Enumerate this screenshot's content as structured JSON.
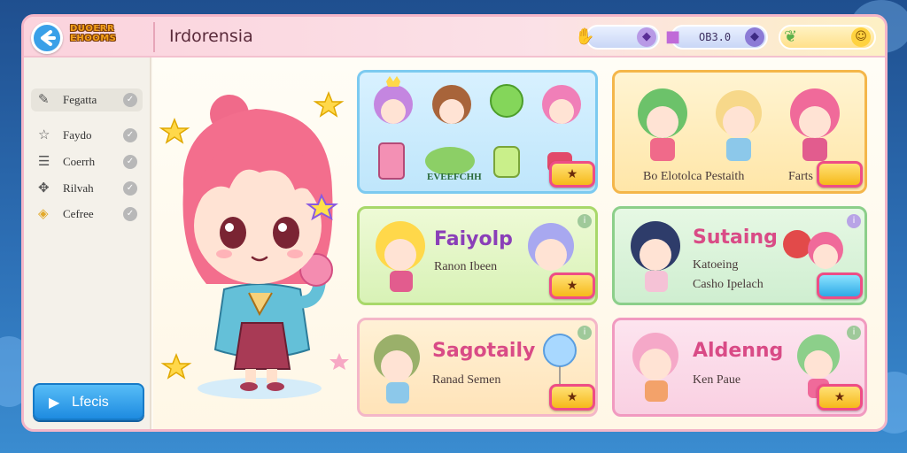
{
  "app": {
    "logo_text": "DUOERR EHOOMS",
    "screen_title": "Irdorensia"
  },
  "topbar": {
    "resource_1_value": "",
    "resource_2_value": "OB3.0",
    "resource_3_value": ""
  },
  "sidebar": {
    "items": [
      {
        "label": "Fegatta",
        "icon": "edit-icon",
        "checked": true
      },
      {
        "label": "Faydo",
        "icon": "star-outline-icon",
        "checked": true
      },
      {
        "label": "Coerrh",
        "icon": "database-icon",
        "checked": true
      },
      {
        "label": "Rilvah",
        "icon": "puzzle-icon",
        "checked": true
      },
      {
        "label": "Cefree",
        "icon": "coins-icon",
        "checked": true
      }
    ],
    "play_button_label": "Lfecis"
  },
  "cards": [
    {
      "id": "card-items",
      "title": "",
      "subtitle": "EVEEFCHH",
      "badge": "",
      "theme": "blue"
    },
    {
      "id": "card-group",
      "title": "",
      "subtitle": "Bo Elotolca Pestaith",
      "extra": "Farts",
      "badge": "",
      "theme": "gold"
    },
    {
      "id": "card-faiyolp",
      "title": "Faiyolp",
      "subtitle": "Ranon Ibeen",
      "badge": "",
      "theme": "green"
    },
    {
      "id": "card-satoing",
      "title": "Sutaing",
      "subtitle_1": "Katoeing",
      "subtitle_2": "Casho Ipelach",
      "badge": "",
      "theme": "mint"
    },
    {
      "id": "card-sagotaily",
      "title": "Sagotaily",
      "subtitle": "Ranad Semen",
      "badge": "",
      "theme": "peach"
    },
    {
      "id": "card-aldening",
      "title": "Aldenng",
      "subtitle": "Ken Paue",
      "badge": "",
      "theme": "pink"
    }
  ],
  "colors": {
    "background": "#2d6fb5",
    "window_border": "#f4b6c8",
    "topbar": "#fbd3dd",
    "play_button": "#2b9ae6",
    "title_pink": "#d94b86",
    "title_purple": "#8a3fb8",
    "badge_gold": "#f6b91a",
    "badge_border": "#ee4d86"
  }
}
